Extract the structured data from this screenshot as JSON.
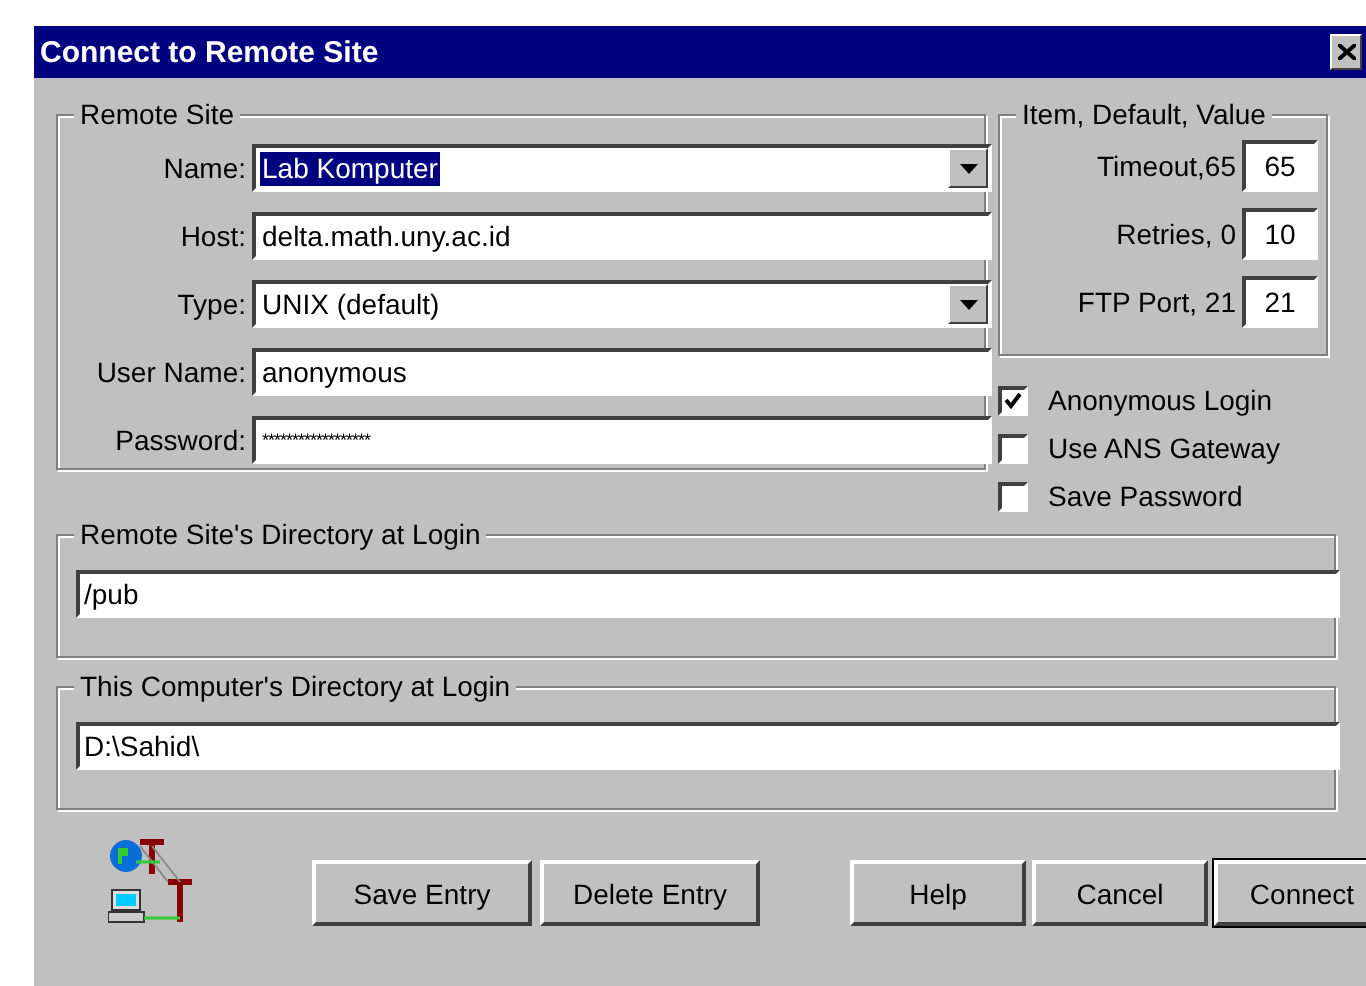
{
  "window": {
    "title": "Connect to Remote Site"
  },
  "remote_site": {
    "title": "Remote Site",
    "fields": [
      {
        "label": "Name:",
        "kind": "dropdown",
        "value": "Lab Komputer",
        "highlighted": true
      },
      {
        "label": "Host:",
        "kind": "text",
        "value": "delta.math.uny.ac.id",
        "highlighted": false
      },
      {
        "label": "Type:",
        "kind": "dropdown",
        "value": "UNIX (default)",
        "highlighted": false
      },
      {
        "label": "User Name:",
        "kind": "text",
        "value": "anonymous",
        "highlighted": false
      },
      {
        "label": "Password:",
        "kind": "password",
        "value": "******************",
        "highlighted": false
      }
    ]
  },
  "settings": {
    "title": "Item, Default, Value",
    "items": [
      {
        "label": "Timeout,65",
        "value": "65"
      },
      {
        "label": "Retries, 0",
        "value": "10"
      },
      {
        "label": "FTP Port, 21",
        "value": "21"
      }
    ]
  },
  "options": [
    {
      "label": "Anonymous Login",
      "checked": true
    },
    {
      "label": "Use ANS Gateway",
      "checked": false
    },
    {
      "label": "Save Password",
      "checked": false
    }
  ],
  "directories": [
    {
      "title": "Remote Site's Directory at Login",
      "value": "/pub"
    },
    {
      "title": "This Computer's Directory at Login",
      "value": "D:\\Sahid\\"
    }
  ],
  "entry_buttons": [
    {
      "label": "Save Entry",
      "default": false
    },
    {
      "label": "Delete Entry",
      "default": false
    }
  ],
  "dialog_buttons": [
    {
      "label": "Help",
      "default": false
    },
    {
      "label": "Cancel",
      "default": false
    },
    {
      "label": "Connect",
      "default": true
    }
  ]
}
